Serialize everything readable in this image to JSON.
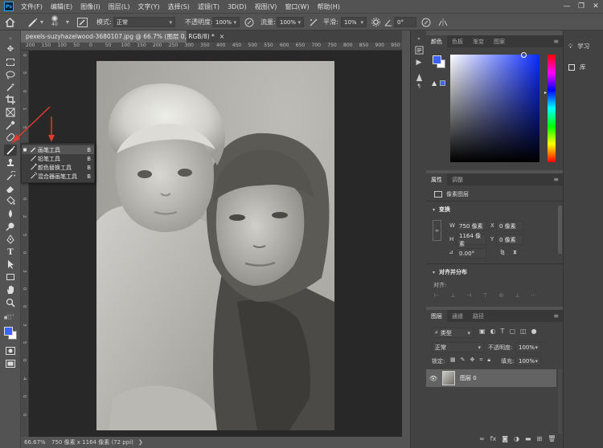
{
  "menubar": {
    "logo": "Ps",
    "items": [
      "文件(F)",
      "编辑(E)",
      "图像(I)",
      "图层(L)",
      "文字(Y)",
      "选择(S)",
      "滤镜(T)",
      "3D(D)",
      "视图(V)",
      "窗口(W)",
      "帮助(H)"
    ],
    "minimize": "—",
    "restore": "❐",
    "close": "✕"
  },
  "options": {
    "brush_size": "40",
    "mode_label": "模式:",
    "mode_value": "正常",
    "opacity_label": "不透明度:",
    "opacity_value": "100%",
    "flow_label": "流量:",
    "flow_value": "100%",
    "smooth_label": "平滑:",
    "smooth_value": "10%",
    "angle_value": "0°"
  },
  "document": {
    "tab_title": "pexels-suzyhazelwood-3680107.jpg @ 66.7% (图层 0, RGB/8) *",
    "close": "×",
    "ruler_top": [
      "200",
      "150",
      "100",
      "50",
      "0",
      "50",
      "100",
      "150",
      "200",
      "250",
      "300",
      "350",
      "400",
      "450",
      "500",
      "550",
      "600",
      "650",
      "700",
      "750",
      "800",
      "850",
      "900",
      "950"
    ],
    "ruler_left": [
      "0",
      "5",
      "0",
      "1",
      "5",
      "0",
      "2",
      "0",
      "0",
      "2",
      "5",
      "0",
      "3",
      "0",
      "0",
      "3",
      "5",
      "0",
      "4",
      "0",
      "0"
    ]
  },
  "status": {
    "zoom": "66.67%",
    "info": "750 像素 x 1164 像素 (72 ppi)"
  },
  "flyout": {
    "items": [
      {
        "label": "画笔工具",
        "key": "B"
      },
      {
        "label": "铅笔工具",
        "key": "B"
      },
      {
        "label": "颜色替换工具",
        "key": "B"
      },
      {
        "label": "混合器画笔工具",
        "key": "B"
      }
    ]
  },
  "color_panel": {
    "tabs": [
      "颜色",
      "色板",
      "渐变",
      "图案"
    ],
    "fg_color": "#3d63ff",
    "bg_color": "#ffffff"
  },
  "properties_panel": {
    "tabs": [
      "属性",
      "调整"
    ],
    "layer_type": "像素图层",
    "transform_title": "变换",
    "w_label": "W",
    "w_value": "750 像素",
    "x_label": "X",
    "x_value": "0 像素",
    "h_label": "H",
    "h_value": "1164 像素",
    "y_label": "Y",
    "y_value": "0 像素",
    "angle_value": "0.00°",
    "align_title": "对齐并分布",
    "align_label": "对齐:"
  },
  "layers_panel": {
    "tabs": [
      "图层",
      "通道",
      "路径"
    ],
    "filter_kind": "类型",
    "blend_mode": "正常",
    "opacity_label": "不透明度:",
    "opacity_value": "100%",
    "lock_label": "锁定:",
    "fill_label": "填充:",
    "fill_value": "100%",
    "layer_name": "图层 0"
  },
  "learn_panel": {
    "learn_label": "学习",
    "library_label": "库"
  },
  "colors": {
    "accent": "#31a8ff",
    "swatch_fg": "#3d63ff",
    "annotation_arrow": "#e03a2f"
  }
}
